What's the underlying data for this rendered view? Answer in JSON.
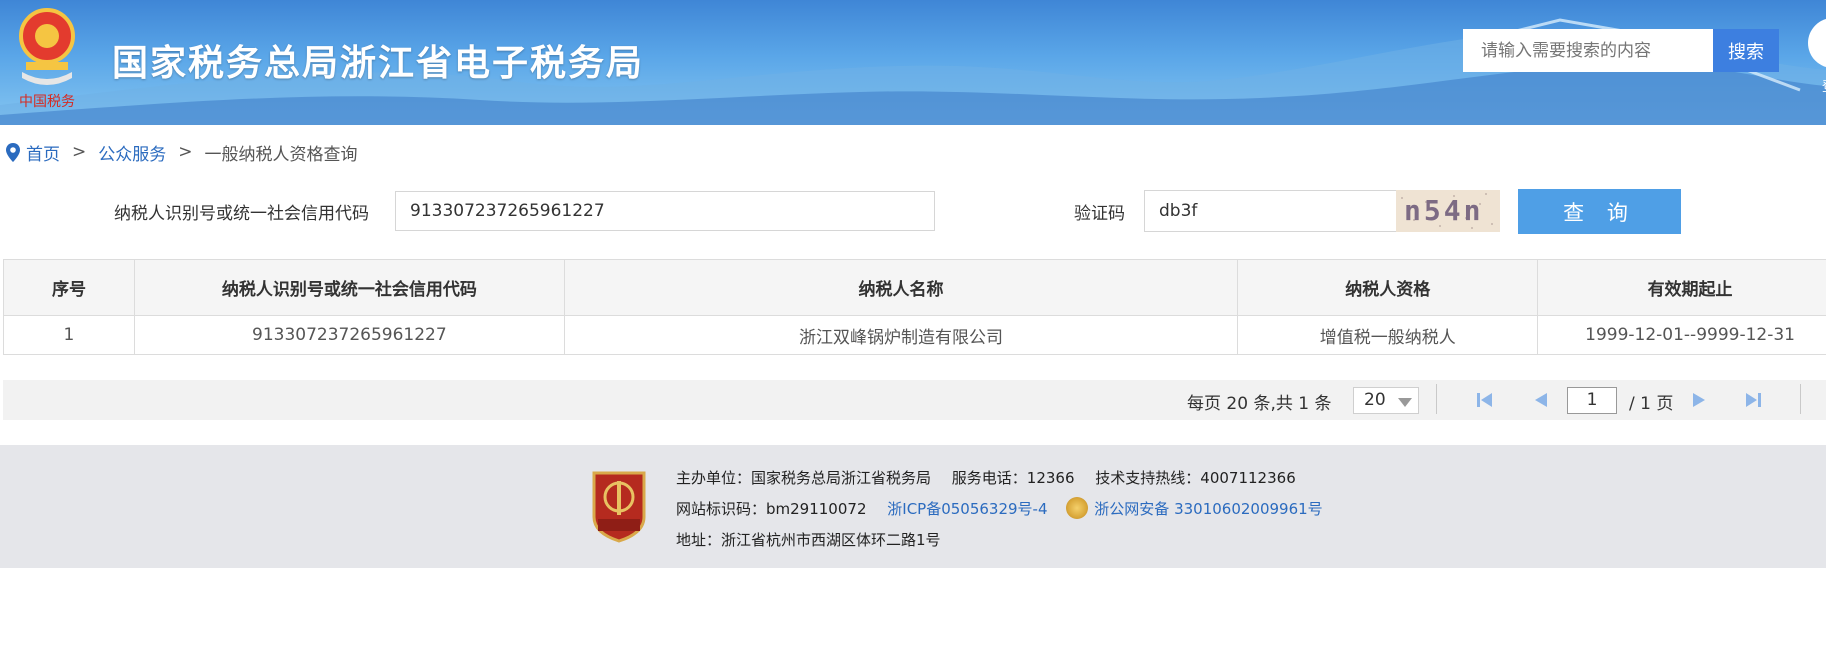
{
  "header": {
    "site_title": "国家税务总局浙江省电子税务局",
    "search_placeholder": "请输入需要搜索的内容",
    "search_button": "搜索",
    "login_label": "登"
  },
  "breadcrumb": {
    "home": "首页",
    "sep": ">",
    "level2": "公众服务",
    "current": "一般纳税人资格查询"
  },
  "form": {
    "taxpayer_id_label": "纳税人识别号或统一社会信用代码",
    "taxpayer_id_value": "913307237265961227",
    "captcha_label": "验证码",
    "captcha_input_value": "db3f",
    "captcha_image_text": "n54n",
    "query_button": "查 询"
  },
  "table": {
    "columns": [
      "序号",
      "纳税人识别号或统一社会信用代码",
      "纳税人名称",
      "纳税人资格",
      "有效期起止"
    ],
    "rows": [
      [
        "1",
        "913307237265961227",
        "浙江双峰锅炉制造有限公司",
        "增值税一般纳税人",
        "1999-12-01--9999-12-31"
      ]
    ]
  },
  "pager": {
    "info": "每页 20 条,共 1 条",
    "page_size": "20",
    "current_page": "1",
    "total_pages": "/ 1 页"
  },
  "footer": {
    "line1": {
      "host": "主办单位：国家税务总局浙江省税务局",
      "phone": "服务电话：12366",
      "support": "技术支持热线：4007112366"
    },
    "line2": {
      "site_id": "网站标识码：bm29110072",
      "icp": "浙ICP备05056329号-4",
      "police": "浙公网安备 33010602009961号"
    },
    "line3": {
      "address": "地址：浙江省杭州市西湖区体环二路1号"
    }
  },
  "colors": {
    "header_blue": "#3f86d6",
    "search_button": "#3d7fe0",
    "query_button": "#4f9fe6",
    "link": "#2b6bbf",
    "footer_bg": "#e5e6ea"
  }
}
